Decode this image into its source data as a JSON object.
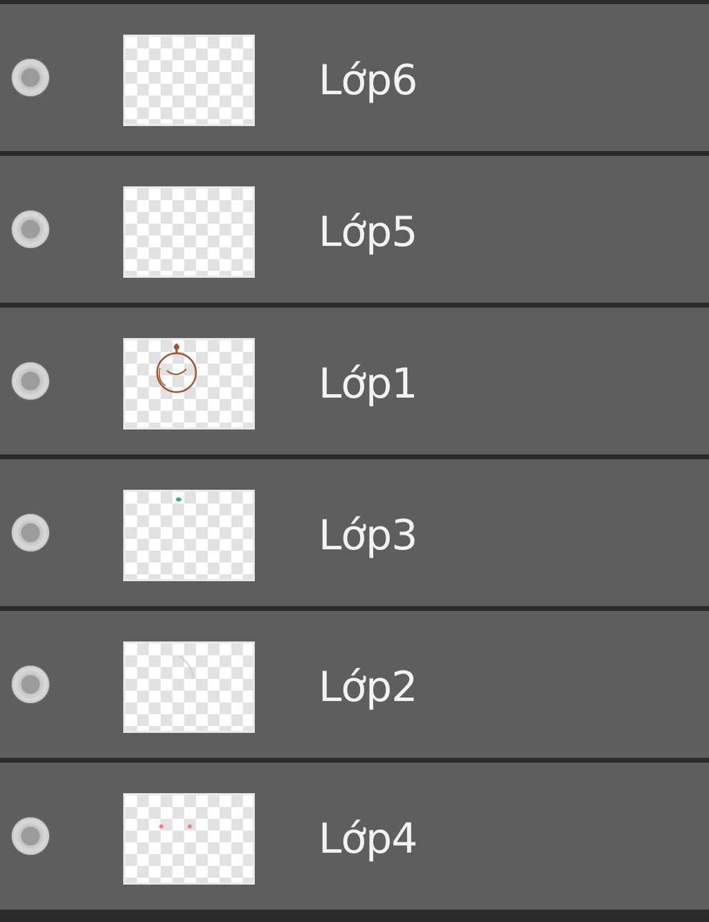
{
  "layers_panel": {
    "layers": [
      {
        "name": "Lớp6",
        "visible": true,
        "thumbnail": "empty"
      },
      {
        "name": "Lớp5",
        "visible": true,
        "thumbnail": "empty"
      },
      {
        "name": "Lớp1",
        "visible": true,
        "thumbnail": "brown-sketch"
      },
      {
        "name": "Lớp3",
        "visible": true,
        "thumbnail": "green-dot"
      },
      {
        "name": "Lớp2",
        "visible": true,
        "thumbnail": "faint-gray-stroke"
      },
      {
        "name": "Lớp4",
        "visible": true,
        "thumbnail": "two-red-dots"
      }
    ],
    "colors": {
      "row_background": "#5e5e5e",
      "separator": "#2b2b2b",
      "label": "#f2f2f2",
      "sketch_brown": "#a0522d",
      "dot_green": "#3cb371",
      "dot_red": "#f08080"
    }
  }
}
